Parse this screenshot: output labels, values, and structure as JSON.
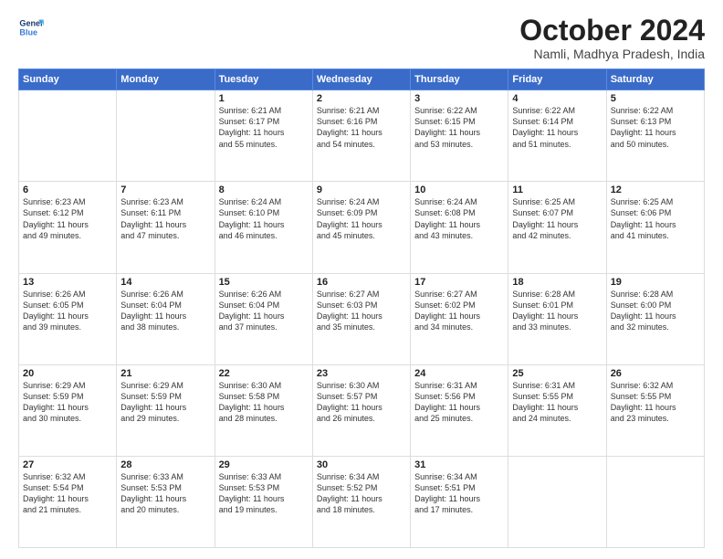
{
  "header": {
    "logo_line1": "General",
    "logo_line2": "Blue",
    "title": "October 2024",
    "subtitle": "Namli, Madhya Pradesh, India"
  },
  "days_of_week": [
    "Sunday",
    "Monday",
    "Tuesday",
    "Wednesday",
    "Thursday",
    "Friday",
    "Saturday"
  ],
  "weeks": [
    [
      {
        "day": "",
        "info": ""
      },
      {
        "day": "",
        "info": ""
      },
      {
        "day": "1",
        "info": "Sunrise: 6:21 AM\nSunset: 6:17 PM\nDaylight: 11 hours\nand 55 minutes."
      },
      {
        "day": "2",
        "info": "Sunrise: 6:21 AM\nSunset: 6:16 PM\nDaylight: 11 hours\nand 54 minutes."
      },
      {
        "day": "3",
        "info": "Sunrise: 6:22 AM\nSunset: 6:15 PM\nDaylight: 11 hours\nand 53 minutes."
      },
      {
        "day": "4",
        "info": "Sunrise: 6:22 AM\nSunset: 6:14 PM\nDaylight: 11 hours\nand 51 minutes."
      },
      {
        "day": "5",
        "info": "Sunrise: 6:22 AM\nSunset: 6:13 PM\nDaylight: 11 hours\nand 50 minutes."
      }
    ],
    [
      {
        "day": "6",
        "info": "Sunrise: 6:23 AM\nSunset: 6:12 PM\nDaylight: 11 hours\nand 49 minutes."
      },
      {
        "day": "7",
        "info": "Sunrise: 6:23 AM\nSunset: 6:11 PM\nDaylight: 11 hours\nand 47 minutes."
      },
      {
        "day": "8",
        "info": "Sunrise: 6:24 AM\nSunset: 6:10 PM\nDaylight: 11 hours\nand 46 minutes."
      },
      {
        "day": "9",
        "info": "Sunrise: 6:24 AM\nSunset: 6:09 PM\nDaylight: 11 hours\nand 45 minutes."
      },
      {
        "day": "10",
        "info": "Sunrise: 6:24 AM\nSunset: 6:08 PM\nDaylight: 11 hours\nand 43 minutes."
      },
      {
        "day": "11",
        "info": "Sunrise: 6:25 AM\nSunset: 6:07 PM\nDaylight: 11 hours\nand 42 minutes."
      },
      {
        "day": "12",
        "info": "Sunrise: 6:25 AM\nSunset: 6:06 PM\nDaylight: 11 hours\nand 41 minutes."
      }
    ],
    [
      {
        "day": "13",
        "info": "Sunrise: 6:26 AM\nSunset: 6:05 PM\nDaylight: 11 hours\nand 39 minutes."
      },
      {
        "day": "14",
        "info": "Sunrise: 6:26 AM\nSunset: 6:04 PM\nDaylight: 11 hours\nand 38 minutes."
      },
      {
        "day": "15",
        "info": "Sunrise: 6:26 AM\nSunset: 6:04 PM\nDaylight: 11 hours\nand 37 minutes."
      },
      {
        "day": "16",
        "info": "Sunrise: 6:27 AM\nSunset: 6:03 PM\nDaylight: 11 hours\nand 35 minutes."
      },
      {
        "day": "17",
        "info": "Sunrise: 6:27 AM\nSunset: 6:02 PM\nDaylight: 11 hours\nand 34 minutes."
      },
      {
        "day": "18",
        "info": "Sunrise: 6:28 AM\nSunset: 6:01 PM\nDaylight: 11 hours\nand 33 minutes."
      },
      {
        "day": "19",
        "info": "Sunrise: 6:28 AM\nSunset: 6:00 PM\nDaylight: 11 hours\nand 32 minutes."
      }
    ],
    [
      {
        "day": "20",
        "info": "Sunrise: 6:29 AM\nSunset: 5:59 PM\nDaylight: 11 hours\nand 30 minutes."
      },
      {
        "day": "21",
        "info": "Sunrise: 6:29 AM\nSunset: 5:59 PM\nDaylight: 11 hours\nand 29 minutes."
      },
      {
        "day": "22",
        "info": "Sunrise: 6:30 AM\nSunset: 5:58 PM\nDaylight: 11 hours\nand 28 minutes."
      },
      {
        "day": "23",
        "info": "Sunrise: 6:30 AM\nSunset: 5:57 PM\nDaylight: 11 hours\nand 26 minutes."
      },
      {
        "day": "24",
        "info": "Sunrise: 6:31 AM\nSunset: 5:56 PM\nDaylight: 11 hours\nand 25 minutes."
      },
      {
        "day": "25",
        "info": "Sunrise: 6:31 AM\nSunset: 5:55 PM\nDaylight: 11 hours\nand 24 minutes."
      },
      {
        "day": "26",
        "info": "Sunrise: 6:32 AM\nSunset: 5:55 PM\nDaylight: 11 hours\nand 23 minutes."
      }
    ],
    [
      {
        "day": "27",
        "info": "Sunrise: 6:32 AM\nSunset: 5:54 PM\nDaylight: 11 hours\nand 21 minutes."
      },
      {
        "day": "28",
        "info": "Sunrise: 6:33 AM\nSunset: 5:53 PM\nDaylight: 11 hours\nand 20 minutes."
      },
      {
        "day": "29",
        "info": "Sunrise: 6:33 AM\nSunset: 5:53 PM\nDaylight: 11 hours\nand 19 minutes."
      },
      {
        "day": "30",
        "info": "Sunrise: 6:34 AM\nSunset: 5:52 PM\nDaylight: 11 hours\nand 18 minutes."
      },
      {
        "day": "31",
        "info": "Sunrise: 6:34 AM\nSunset: 5:51 PM\nDaylight: 11 hours\nand 17 minutes."
      },
      {
        "day": "",
        "info": ""
      },
      {
        "day": "",
        "info": ""
      }
    ]
  ]
}
